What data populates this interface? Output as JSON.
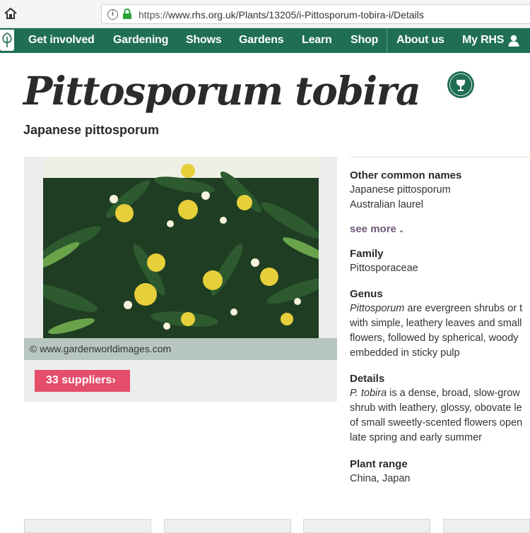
{
  "browser": {
    "url_scheme": "https://",
    "url_rest": "www.rhs.org.uk/Plants/13205/i-Pittosporum-tobira-i/Details"
  },
  "nav": {
    "items": [
      {
        "label": "Get involved",
        "id": "get-involved"
      },
      {
        "label": "Gardening",
        "id": "gardening"
      },
      {
        "label": "Shows",
        "id": "shows"
      },
      {
        "label": "Gardens",
        "id": "gardens"
      },
      {
        "label": "Learn",
        "id": "learn"
      },
      {
        "label": "Shop",
        "id": "shop"
      },
      {
        "label": "About us",
        "id": "about-us"
      },
      {
        "label": "My RHS",
        "id": "my-rhs"
      }
    ]
  },
  "plant": {
    "title": "Pittosporum tobira",
    "common_name": "Japanese pittosporum",
    "award_text": "RHS AWARD Garden Merit"
  },
  "image": {
    "credit": "© www.gardenworldimages.com",
    "suppliers_label": "33 suppliers›"
  },
  "info": {
    "other_names_heading": "Other common names",
    "other_names": [
      "Japanese pittosporum",
      "Australian laurel"
    ],
    "see_more": "see more",
    "family_heading": "Family",
    "family": "Pittosporaceae",
    "genus_heading": "Genus",
    "genus_italic": "Pittosporum",
    "genus_lines": [
      " are evergreen shrubs or t",
      "with simple, leathery leaves and small",
      "flowers, followed by spherical, woody",
      "embedded in sticky pulp"
    ],
    "details_heading": "Details",
    "details_italic": "P. tobira",
    "details_lines": [
      " is a dense, broad, slow-grow",
      "shrub with leathery, glossy, obovate le",
      "of small sweetly-scented flowers open",
      "late spring and early summer"
    ],
    "range_heading": "Plant range",
    "range": "China, Japan"
  },
  "colors": {
    "nav_green": "#1f6e55",
    "suppliers_pink": "#e54e6b",
    "see_more_purple": "#6f5a79"
  }
}
